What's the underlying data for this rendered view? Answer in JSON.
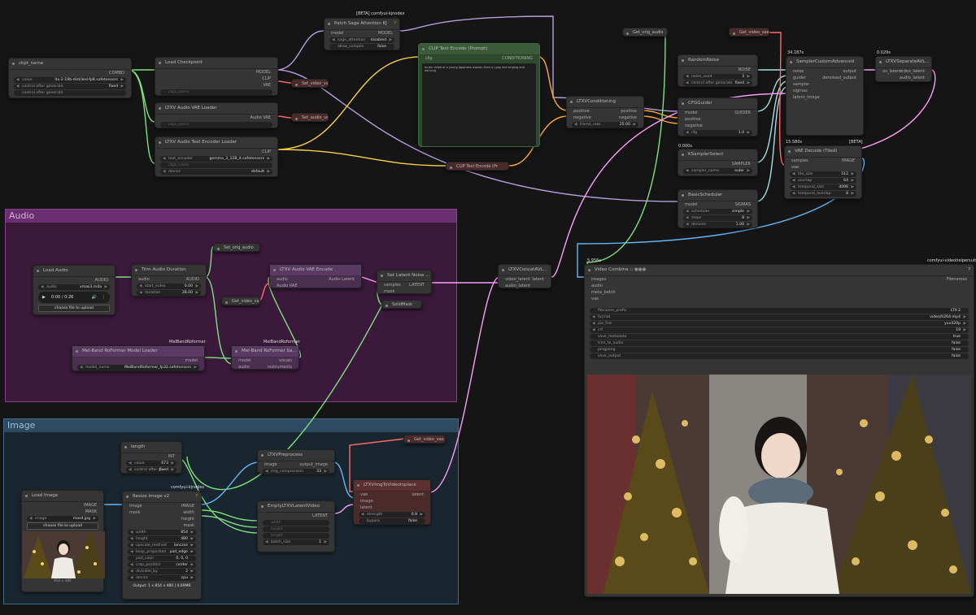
{
  "groups": {
    "audio": {
      "title": "Audio",
      "color": "#a04ea8"
    },
    "image": {
      "title": "Image",
      "color": "#3d6a8a"
    }
  },
  "tags": {
    "kjnodes_top": "[BETA] comfyui-kjnodes",
    "kjnodes_resize": "comfyui-kjnodes",
    "beta_vae": "[BETA]",
    "melband1": "MelBandRoformer",
    "melband2": "MelBandRoformer",
    "vhs": "comfyui-videohelpersuite",
    "t_sampler": "34.187s",
    "t_sep": "0.029s",
    "t_vae": "15.580s",
    "t_ksel": "0.000s",
    "t_vc": "5.956s"
  },
  "ckpt_name": {
    "title": "ckpt_name",
    "out": "COMBO",
    "value_label": "value",
    "value": "ltx-2-19b-distilled-fp8.safetensors",
    "cag_label": "control after generate",
    "cag_value": "fixed",
    "cag2": "control after generate"
  },
  "load_ckpt": {
    "title": "Load Checkpoint",
    "o1": "MODEL",
    "o2": "CLIP",
    "o3": "VAE",
    "w": "ckpt_name"
  },
  "audio_vae_loader": {
    "title": "LTXV Audio VAE Loader",
    "o1": "Audio VAE",
    "w": "ckpt_name"
  },
  "text_enc_loader": {
    "title": "LTXV Audio Text Encoder Loader",
    "o1": "CLIP",
    "te_label": "text_encoder",
    "te_value": "gemma_3_12B_it.safetensors",
    "ck": "ckpt_name",
    "dev_label": "device",
    "dev_value": "default"
  },
  "sage": {
    "title": "Patch Sage Attention KJ",
    "in": "model",
    "out": "MODEL",
    "sa_label": "sage_attention",
    "sa_value": "disabled",
    "ac_label": "allow_compile",
    "ac_value": "false"
  },
  "set_video_vae": {
    "title": "Set_video_vae"
  },
  "set_audio_vae": {
    "title": "Set_audio_vae"
  },
  "clip_prompt": {
    "title": "CLIP Text Encode (Prompt)",
    "in": "clip",
    "out": "CONDITIONING",
    "text": "music video of a young Japanese woman from a j-pop idol singing and dancing"
  },
  "clip_neg": {
    "title": "CLIP Text Encode (Pr"
  },
  "get_orig_audio": {
    "title": "Get_orig_audio"
  },
  "get_video_vae": {
    "title": "Get_video_vae"
  },
  "ltxv_cond": {
    "title": "LTXVConditioning",
    "i1": "positive",
    "i2": "negative",
    "o1": "positive",
    "o2": "negative",
    "fr_label": "frame_rate",
    "fr_value": "25.00"
  },
  "random_noise": {
    "title": "RandomNoise",
    "out": "NOISE",
    "ns_label": "noise_seed",
    "ns_value": "3",
    "cag_label": "control after generate",
    "cag_value": "fixed"
  },
  "cfg_guider": {
    "title": "CFGGuider",
    "i1": "model",
    "i2": "positive",
    "i3": "negative",
    "out": "GUIDER",
    "cfg_label": "cfg",
    "cfg_value": "1.0"
  },
  "ksampler_sel": {
    "title": "KSamplerSelect",
    "out": "SAMPLER",
    "sn_label": "sampler_name",
    "sn_value": "euler"
  },
  "basic_sched": {
    "title": "BasicScheduler",
    "in": "model",
    "out": "SIGMAS",
    "sc_label": "scheduler",
    "sc_value": "simple",
    "st_label": "steps",
    "st_value": "8",
    "dn_label": "denoise",
    "dn_value": "1.00"
  },
  "sampler_adv": {
    "title": "SamplerCustomAdvanced",
    "i1": "noise",
    "i2": "guider",
    "i3": "sampler",
    "i4": "sigmas",
    "i5": "latent_image",
    "o1": "output",
    "o2": "denoised_output"
  },
  "ltxv_sep": {
    "title": "LTXVSeparateAVL...",
    "in": "av_latent",
    "o1": "video_latent",
    "o2": "audio_latent"
  },
  "vae_tiled": {
    "title": "VAE Decode (Tiled)",
    "i1": "samples",
    "i2": "vae",
    "out": "IMAGE",
    "ts_label": "tile_size",
    "ts_value": "512",
    "ov_label": "overlap",
    "ov_value": "64",
    "tsz_label": "temporal_size",
    "tsz_value": "4096",
    "to_label": "temporal_overlap",
    "to_value": "8"
  },
  "load_audio": {
    "title": "Load Audio",
    "out": "AUDIO",
    "a_label": "audio",
    "a_value": "xmas3.m4a",
    "time": "0:00 / 0:26",
    "choose": "choose file to upload"
  },
  "trim_audio": {
    "title": "Trim Audio Duration",
    "in": "audio",
    "out": "AUDIO",
    "si_label": "start_index",
    "si_value": "0.00",
    "du_label": "duration",
    "du_value": "28.00"
  },
  "set_orig_audio": {
    "title": "Set_orig_audio"
  },
  "get_video_vae2": {
    "title": "Get_video_vae"
  },
  "audio_vae_enc": {
    "title": "LTXV Audio VAE Encode",
    "i1": "audio",
    "i2": "Audio VAE",
    "out": "Audio Latent"
  },
  "set_latent_mask": {
    "title": "Set Latent Noise ...",
    "i1": "samples",
    "i2": "mask",
    "out": "LATENT"
  },
  "solid_mask": {
    "title": "SolidMask"
  },
  "melband_loader": {
    "title": "Mel-Band RoFormer Model Loader",
    "out": "model",
    "mn_label": "model_name",
    "mn_value": "MelBandRoformer_fp32.safetensors"
  },
  "melband_sa": {
    "title": "Mel-Band RoFormer Sa...",
    "i1": "model",
    "i2": "audio",
    "o1": "vocals",
    "o2": "instruments"
  },
  "concat": {
    "title": "LTXVConcatAVL...",
    "i1": "video_latent",
    "i2": "audio_latent",
    "out": "latent"
  },
  "video_combine": {
    "title": "Video Combine",
    "i1": "images",
    "i2": "audio",
    "i3": "meta_batch",
    "i4": "vae",
    "out": "Filenames",
    "w": [
      [
        "filename_prefix",
        "LTX-2"
      ],
      [
        "format",
        "video/h264-mp4"
      ],
      [
        "pix_fmt",
        "yuv420p"
      ],
      [
        "crf",
        "19"
      ],
      [
        "save_metadata",
        "true"
      ],
      [
        "trim_to_audio",
        "false"
      ],
      [
        "pingpong",
        "false"
      ],
      [
        "save_output",
        "false"
      ]
    ]
  },
  "length": {
    "title": "length",
    "out": "INT",
    "v_label": "value",
    "v_value": "673",
    "c_label": "control after g...",
    "c_value": "fixed"
  },
  "load_image": {
    "title": "Load Image",
    "o1": "IMAGE",
    "o2": "MASK",
    "im_label": "image",
    "im_value": "mas4.jpg",
    "choose": "choose file to upload",
    "dims": "854 × 480"
  },
  "resize": {
    "title": "Resize Image v2",
    "i1": "image",
    "i2": "mask",
    "o1": "IMAGE",
    "o2": "width",
    "o3": "height",
    "o4": "mask",
    "w": [
      [
        "width",
        "854"
      ],
      [
        "height",
        "480"
      ],
      [
        "upscale_method",
        "lanczos"
      ],
      [
        "keep_proportion",
        "pad_edge"
      ],
      [
        "pad_color",
        "0, 0, 0"
      ],
      [
        "crop_position",
        "center"
      ],
      [
        "divisible_by",
        "2"
      ],
      [
        "device",
        "cpu"
      ]
    ],
    "output": "Output: 1 x 854 x 480 | 4.69MB"
  },
  "preprocess": {
    "title": "LTXVPreprocess",
    "in": "image",
    "out": "output_image",
    "ic_label": "img_compression",
    "ic_value": "33"
  },
  "empty_latent": {
    "title": "EmptyLTXVLatentVideo",
    "out": "LATENT",
    "i1": "width",
    "i2": "height",
    "i3": "length",
    "bs_label": "batch_size",
    "bs_value": "1"
  },
  "get_video_vae3": {
    "title": "Get_video_vae"
  },
  "img_to_video": {
    "title": "LTXVImgToVideoInplace",
    "i1": "vae",
    "i2": "image",
    "i3": "latent",
    "out": "latent",
    "s_label": "strength",
    "s_value": "0.8",
    "b_label": "bypass",
    "b_value": "false"
  },
  "colors": {
    "model": "#b39ddb",
    "clip": "#f7d046",
    "vae": "#ff6b6b",
    "latent": "#ff9cf9",
    "image": "#64b5f6",
    "cond": "#ffa931",
    "int": "#7fe07f",
    "audio": "#7fe07f",
    "sigmas": "#a7e0e0"
  }
}
